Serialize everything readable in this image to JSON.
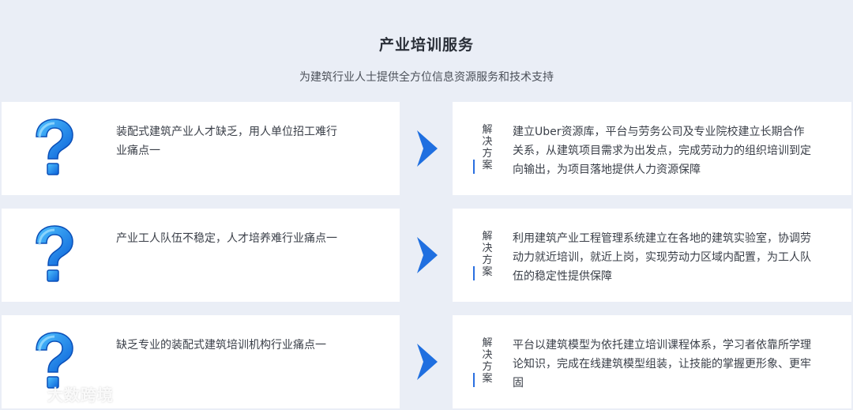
{
  "header": {
    "title": "产业培训服务",
    "subtitle": "为建筑行业人士提供全方位信息资源服务和技术支持"
  },
  "rows": [
    {
      "problem": "装配式建筑产业人才缺乏，用人单位招工难行业痛点一",
      "solution_label": "解决方案",
      "solution": "建立Uber资源库，平台与劳务公司及专业院校建立长期合作关系，从建筑项目需求为出发点，完成劳动力的组织培训到定向输出，为项目落地提供人力资源保障"
    },
    {
      "problem": "产业工人队伍不稳定，人才培养难行业痛点一",
      "solution_label": "解决方案",
      "solution": "利用建筑产业工程管理系统建立在各地的建筑实验室，协调劳动力就近培训，就近上岗，实现劳动力区域内配置，为工人队伍的稳定性提供保障"
    },
    {
      "problem": "缺乏专业的装配式建筑培训机构行业痛点一",
      "solution_label": "解决方案",
      "solution": "平台以建筑模型为依托建立培训课程体系，学习者依靠所学理论知识，完成在线建筑模型组装，让技能的掌握更形象、更牢固"
    }
  ],
  "icons": {
    "problem": "question-mark-icon",
    "transition": "chevron-right-icon"
  },
  "colors": {
    "accent": "#2a6fe0",
    "question": "#1e8ff0",
    "background": "#eaeef6"
  },
  "watermark": {
    "text": "大数跨境"
  }
}
